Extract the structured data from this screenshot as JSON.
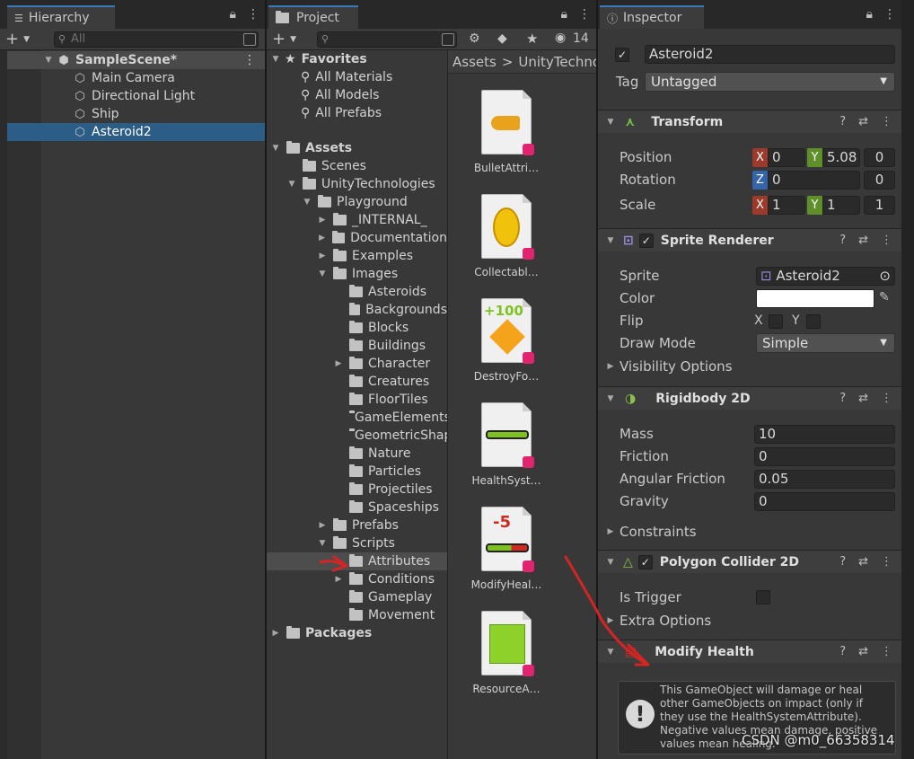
{
  "hierarchy": {
    "tab_title": "Hierarchy",
    "search_placeholder": "All",
    "scene_name": "SampleScene*",
    "items": [
      "Main Camera",
      "Directional Light",
      "Ship",
      "Asteroid2"
    ]
  },
  "project": {
    "tab_title": "Project",
    "hidden_count": "14",
    "favorites": {
      "label": "Favorites",
      "items": [
        "All Materials",
        "All Models",
        "All Prefabs"
      ]
    },
    "tree": {
      "assets": "Assets",
      "scenes": "Scenes",
      "unity_tech": "UnityTechnologies",
      "playground": "Playground",
      "internal": "_INTERNAL_",
      "documentation": "Documentation",
      "examples": "Examples",
      "images": "Images",
      "image_folders": [
        "Asteroids",
        "Backgrounds",
        "Blocks",
        "Buildings",
        "Character",
        "Creatures",
        "FloorTiles",
        "GameElements",
        "GeometricShapes",
        "Nature",
        "Particles",
        "Projectiles",
        "Spaceships"
      ],
      "prefabs": "Prefabs",
      "scripts": "Scripts",
      "script_folders": [
        "Attributes",
        "Conditions",
        "Gameplay",
        "Movement"
      ],
      "packages": "Packages"
    },
    "breadcrumb": [
      "Assets",
      "UnityTechnologies"
    ],
    "breadcrumb_sep": ">",
    "assets": [
      {
        "name": "BulletAttri…",
        "badge": ""
      },
      {
        "name": "Collectabl…",
        "badge": ""
      },
      {
        "name": "DestroyFo…",
        "badge": "+100"
      },
      {
        "name": "HealthSyst…",
        "badge": ""
      },
      {
        "name": "ModifyHeal…",
        "badge": "-5"
      },
      {
        "name": "ResourceA…",
        "badge": ""
      }
    ]
  },
  "inspector": {
    "tab_title": "Inspector",
    "object_name": "Asteroid2",
    "tag_label": "Tag",
    "tag_value": "Untagged",
    "transform": {
      "title": "Transform",
      "position_label": "Position",
      "position": {
        "x": "0",
        "y": "5.08",
        "z": "0"
      },
      "rotation_label": "Rotation",
      "rotation": {
        "z": "0",
        "extra": "0"
      },
      "scale_label": "Scale",
      "scale": {
        "x": "1",
        "y": "1",
        "z": "1"
      }
    },
    "sprite_renderer": {
      "title": "Sprite Renderer",
      "sprite_label": "Sprite",
      "sprite_value": "Asteroid2",
      "color_label": "Color",
      "flip_label": "Flip",
      "flip_x": "X",
      "flip_y": "Y",
      "draw_mode_label": "Draw Mode",
      "draw_mode_value": "Simple",
      "visibility_label": "Visibility Options"
    },
    "rigidbody": {
      "title": "Rigidbody 2D",
      "mass_label": "Mass",
      "mass": "10",
      "friction_label": "Friction",
      "friction": "0",
      "angular_label": "Angular Friction",
      "angular": "0.05",
      "gravity_label": "Gravity",
      "gravity": "0",
      "constraints_label": "Constraints"
    },
    "polygon_collider": {
      "title": "Polygon Collider 2D",
      "is_trigger_label": "Is Trigger",
      "extra_options_label": "Extra Options"
    },
    "modify_health": {
      "title": "Modify Health",
      "info": "This GameObject will damage or heal other GameObjects on impact (only if they use the HealthSystemAttribute). Negative values mean damage, positive values mean healing."
    }
  },
  "watermark": "CSDN @m0_66358314",
  "colors": {
    "selection": "#2c5d87",
    "annotation_arrow": "#d42424",
    "health_green": "#7ec21e"
  }
}
